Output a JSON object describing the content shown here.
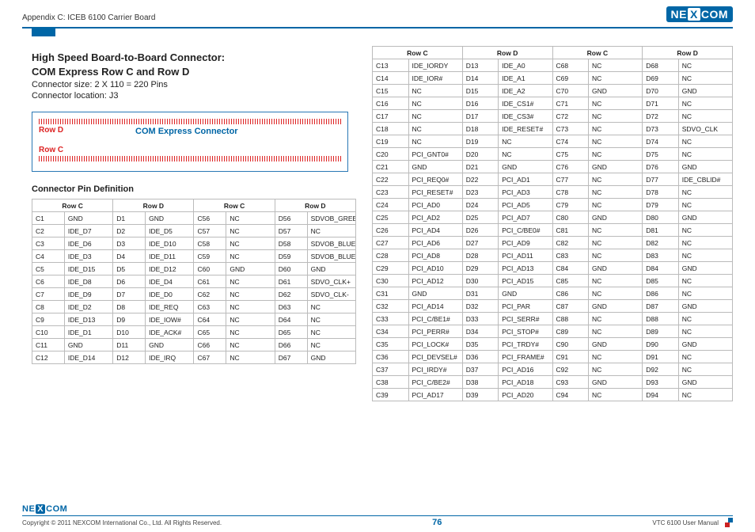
{
  "header": {
    "doc_title": "Appendix C: ICEB 6100 Carrier Board",
    "logo_left": "NE",
    "logo_x": "X",
    "logo_right": "COM"
  },
  "left": {
    "heading_line1": "High Speed Board-to-Board Connector:",
    "heading_line2": "COM Express Row C and Row D",
    "sub1": "Connector size: 2 X 110 = 220 Pins",
    "sub2": "Connector location: J3",
    "conn": {
      "row_d": "Row D",
      "row_c": "Row C",
      "caption": "COM Express Connector"
    },
    "section": "Connector Pin Definition",
    "cols": [
      "Row C",
      "Row D",
      "Row C",
      "Row D"
    ],
    "rows": [
      [
        "C1",
        "GND",
        "D1",
        "GND",
        "C56",
        "NC",
        "D56",
        "SDVOB_GREEN-"
      ],
      [
        "C2",
        "IDE_D7",
        "D2",
        "IDE_D5",
        "C57",
        "NC",
        "D57",
        "NC"
      ],
      [
        "C3",
        "IDE_D6",
        "D3",
        "IDE_D10",
        "C58",
        "NC",
        "D58",
        "SDVOB_BLUE+"
      ],
      [
        "C4",
        "IDE_D3",
        "D4",
        "IDE_D11",
        "C59",
        "NC",
        "D59",
        "SDVOB_BLUE-"
      ],
      [
        "C5",
        "IDE_D15",
        "D5",
        "IDE_D12",
        "C60",
        "GND",
        "D60",
        "GND"
      ],
      [
        "C6",
        "IDE_D8",
        "D6",
        "IDE_D4",
        "C61",
        "NC",
        "D61",
        "SDVO_CLK+"
      ],
      [
        "C7",
        "IDE_D9",
        "D7",
        "IDE_D0",
        "C62",
        "NC",
        "D62",
        "SDVO_CLK-"
      ],
      [
        "C8",
        "IDE_D2",
        "D8",
        "IDE_REQ",
        "C63",
        "NC",
        "D63",
        "NC"
      ],
      [
        "C9",
        "IDE_D13",
        "D9",
        "IDE_IOW#",
        "C64",
        "NC",
        "D64",
        "NC"
      ],
      [
        "C10",
        "IDE_D1",
        "D10",
        "IDE_ACK#",
        "C65",
        "NC",
        "D65",
        "NC"
      ],
      [
        "C11",
        "GND",
        "D11",
        "GND",
        "C66",
        "NC",
        "D66",
        "NC"
      ],
      [
        "C12",
        "IDE_D14",
        "D12",
        "IDE_IRQ",
        "C67",
        "NC",
        "D67",
        "GND"
      ]
    ]
  },
  "right": {
    "cols": [
      "Row C",
      "Row D",
      "Row C",
      "Row D"
    ],
    "rows": [
      [
        "C13",
        "IDE_IORDY",
        "D13",
        "IDE_A0",
        "C68",
        "NC",
        "D68",
        "NC"
      ],
      [
        "C14",
        "IDE_IOR#",
        "D14",
        "IDE_A1",
        "C69",
        "NC",
        "D69",
        "NC"
      ],
      [
        "C15",
        "NC",
        "D15",
        "IDE_A2",
        "C70",
        "GND",
        "D70",
        "GND"
      ],
      [
        "C16",
        "NC",
        "D16",
        "IDE_CS1#",
        "C71",
        "NC",
        "D71",
        "NC"
      ],
      [
        "C17",
        "NC",
        "D17",
        "IDE_CS3#",
        "C72",
        "NC",
        "D72",
        "NC"
      ],
      [
        "C18",
        "NC",
        "D18",
        "IDE_RESET#",
        "C73",
        "NC",
        "D73",
        "SDVO_CLK"
      ],
      [
        "C19",
        "NC",
        "D19",
        "NC",
        "C74",
        "NC",
        "D74",
        "NC"
      ],
      [
        "C20",
        "PCI_GNT0#",
        "D20",
        "NC",
        "C75",
        "NC",
        "D75",
        "NC"
      ],
      [
        "C21",
        "GND",
        "D21",
        "GND",
        "C76",
        "GND",
        "D76",
        "GND"
      ],
      [
        "C22",
        "PCI_REQ0#",
        "D22",
        "PCI_AD1",
        "C77",
        "NC",
        "D77",
        "IDE_CBLID#"
      ],
      [
        "C23",
        "PCI_RESET#",
        "D23",
        "PCI_AD3",
        "C78",
        "NC",
        "D78",
        "NC"
      ],
      [
        "C24",
        "PCI_AD0",
        "D24",
        "PCI_AD5",
        "C79",
        "NC",
        "D79",
        "NC"
      ],
      [
        "C25",
        "PCI_AD2",
        "D25",
        "PCI_AD7",
        "C80",
        "GND",
        "D80",
        "GND"
      ],
      [
        "C26",
        "PCI_AD4",
        "D26",
        "PCI_C/BE0#",
        "C81",
        "NC",
        "D81",
        "NC"
      ],
      [
        "C27",
        "PCI_AD6",
        "D27",
        "PCI_AD9",
        "C82",
        "NC",
        "D82",
        "NC"
      ],
      [
        "C28",
        "PCI_AD8",
        "D28",
        "PCI_AD11",
        "C83",
        "NC",
        "D83",
        "NC"
      ],
      [
        "C29",
        "PCI_AD10",
        "D29",
        "PCI_AD13",
        "C84",
        "GND",
        "D84",
        "GND"
      ],
      [
        "C30",
        "PCI_AD12",
        "D30",
        "PCI_AD15",
        "C85",
        "NC",
        "D85",
        "NC"
      ],
      [
        "C31",
        "GND",
        "D31",
        "GND",
        "C86",
        "NC",
        "D86",
        "NC"
      ],
      [
        "C32",
        "PCI_AD14",
        "D32",
        "PCI_PAR",
        "C87",
        "GND",
        "D87",
        "GND"
      ],
      [
        "C33",
        "PCI_C/BE1#",
        "D33",
        "PCI_SERR#",
        "C88",
        "NC",
        "D88",
        "NC"
      ],
      [
        "C34",
        "PCI_PERR#",
        "D34",
        "PCI_STOP#",
        "C89",
        "NC",
        "D89",
        "NC"
      ],
      [
        "C35",
        "PCI_LOCK#",
        "D35",
        "PCI_TRDY#",
        "C90",
        "GND",
        "D90",
        "GND"
      ],
      [
        "C36",
        "PCI_DEVSEL#",
        "D36",
        "PCI_FRAME#",
        "C91",
        "NC",
        "D91",
        "NC"
      ],
      [
        "C37",
        "PCI_IRDY#",
        "D37",
        "PCI_AD16",
        "C92",
        "NC",
        "D92",
        "NC"
      ],
      [
        "C38",
        "PCI_C/BE2#",
        "D38",
        "PCI_AD18",
        "C93",
        "GND",
        "D93",
        "GND"
      ],
      [
        "C39",
        "PCI_AD17",
        "D39",
        "PCI_AD20",
        "C94",
        "NC",
        "D94",
        "NC"
      ]
    ]
  },
  "footer": {
    "copyright": "Copyright © 2011 NEXCOM International Co., Ltd. All Rights Reserved.",
    "page": "76",
    "manual": "VTC 6100 User Manual",
    "logo_left": "NE",
    "logo_x": "X",
    "logo_right": "COM"
  }
}
